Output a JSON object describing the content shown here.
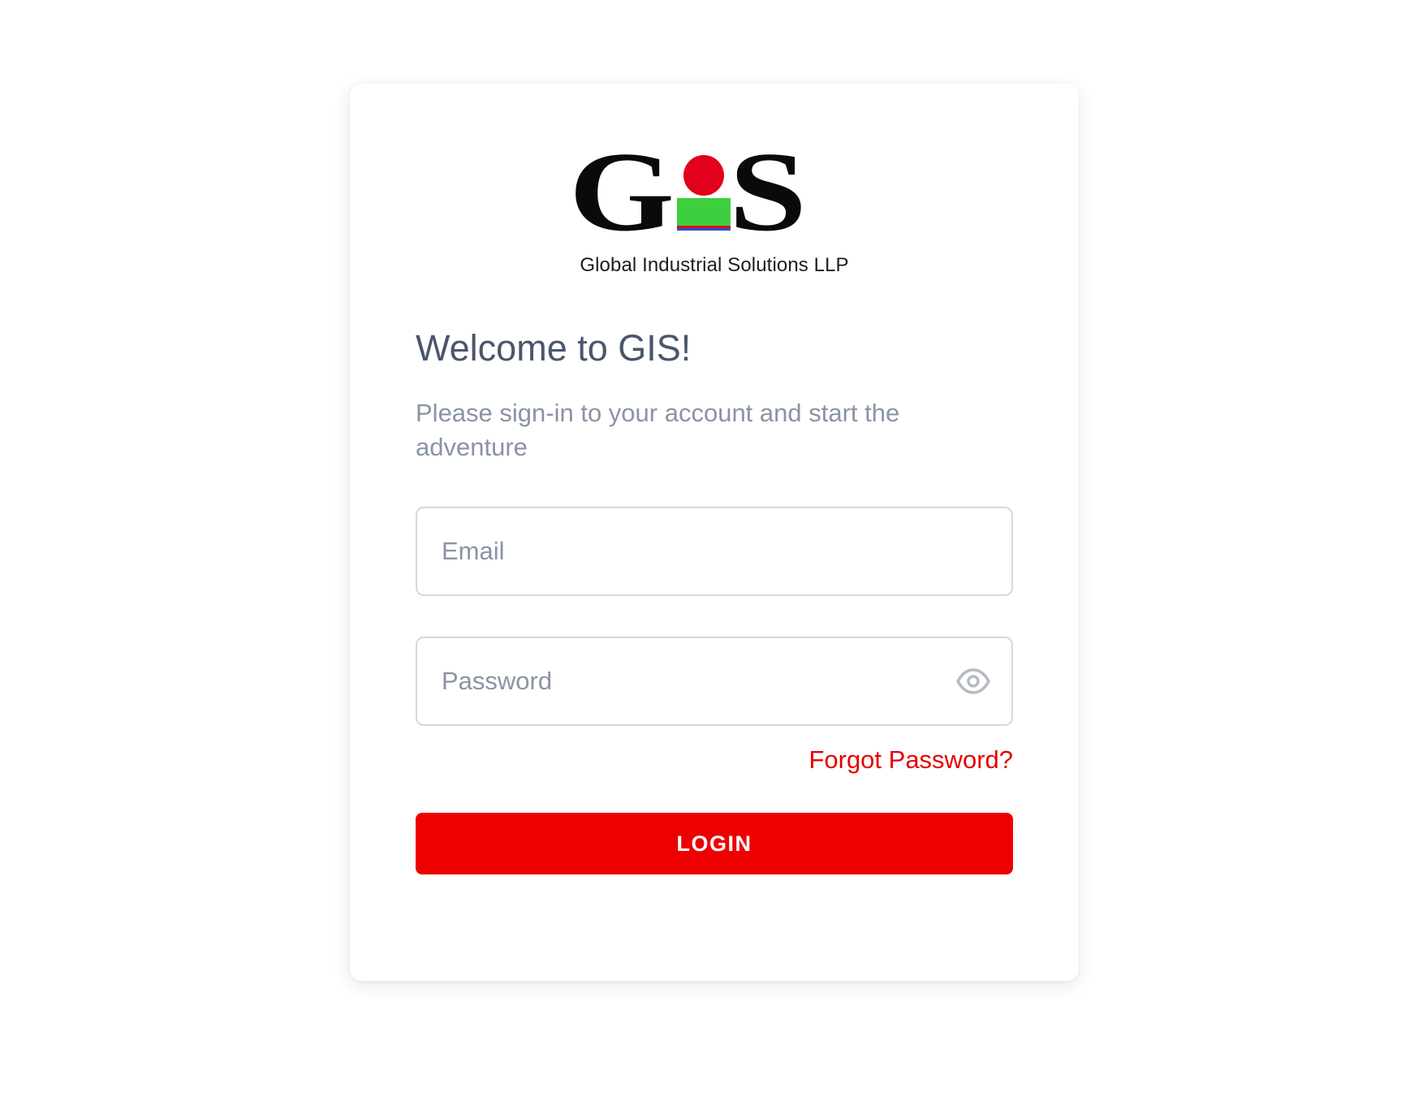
{
  "brand": {
    "logo_text": "GIS",
    "company_name": "Global Industrial Solutions LLP",
    "colors": {
      "logo_black": "#0a0a0a",
      "logo_red": "#e3001b",
      "logo_green": "#3ecf3e",
      "logo_blue": "#2a55c9",
      "accent": "#ee0000"
    }
  },
  "login": {
    "title": "Welcome to GIS!",
    "subtitle": "Please sign-in to your account and start the adventure",
    "email_placeholder": "Email",
    "email_value": "",
    "password_placeholder": "Password",
    "password_value": "",
    "password_toggle_icon": "eye-icon",
    "forgot_label": "Forgot Password?",
    "submit_label": "LOGIN"
  }
}
